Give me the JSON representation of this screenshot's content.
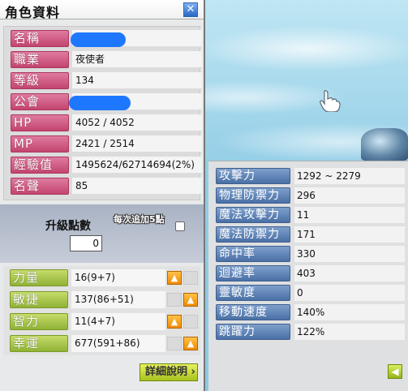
{
  "window": {
    "title": "角色資料"
  },
  "info": [
    {
      "label": "名稱",
      "value": "",
      "redacted": true
    },
    {
      "label": "職業",
      "value": "夜使者"
    },
    {
      "label": "等級",
      "value": "134"
    },
    {
      "label": "公會",
      "value": "",
      "redacted": true
    },
    {
      "label": "HP",
      "value": "4052 / 4052"
    },
    {
      "label": "MP",
      "value": "2421 / 2514"
    },
    {
      "label": "經驗值",
      "value": "1495624/62714694(2%)"
    },
    {
      "label": "名聲",
      "value": "85"
    }
  ],
  "ability_points": {
    "label": "升級點數",
    "value": "0",
    "per_add_label": "每次追加5點",
    "per_add_checked": false
  },
  "stats": [
    {
      "label": "力量",
      "value": "16(9+7)",
      "up_enabled": true
    },
    {
      "label": "敏捷",
      "value": "137(86+51)",
      "up_enabled": true
    },
    {
      "label": "智力",
      "value": "11(4+7)",
      "up_enabled": true
    },
    {
      "label": "幸運",
      "value": "677(591+86)",
      "up_enabled": true
    }
  ],
  "detail_button_label": "詳細說明",
  "detail_stats": [
    {
      "label": "攻擊力",
      "value": "1292 ~ 2279"
    },
    {
      "label": "物理防禦力",
      "value": "296"
    },
    {
      "label": "魔法攻擊力",
      "value": "11"
    },
    {
      "label": "魔法防禦力",
      "value": "171"
    },
    {
      "label": "命中率",
      "value": "330"
    },
    {
      "label": "迴避率",
      "value": "403"
    },
    {
      "label": "靈敏度",
      "value": "0"
    },
    {
      "label": "移動速度",
      "value": "140%"
    },
    {
      "label": "跳躍力",
      "value": "122%"
    }
  ],
  "icons": {
    "close": "close-icon",
    "up": "arrow-up-icon",
    "back": "arrow-left-icon",
    "cursor": "hand-cursor-icon"
  }
}
